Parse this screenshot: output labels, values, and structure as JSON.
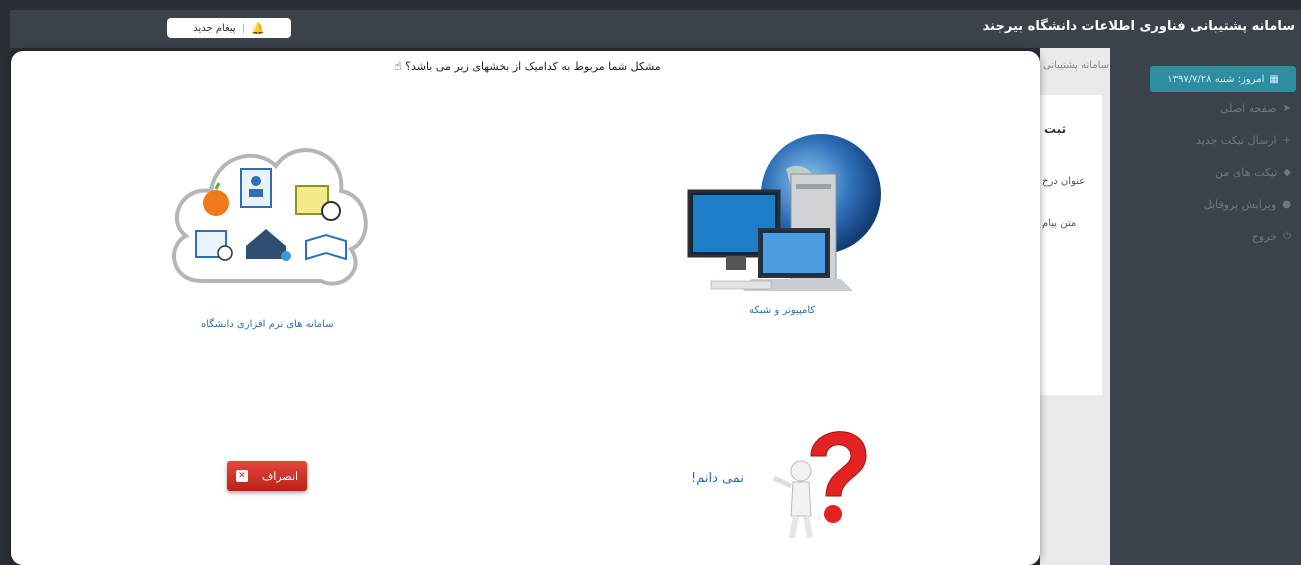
{
  "header": {
    "title": "سامانه پشتیبانی فناوری اطلاعات دانشگاه بیرجند",
    "new_message_label": "پیغام جدید",
    "bell_icon": "bell-icon",
    "separator": "|"
  },
  "sidebar": {
    "date_label": "امروز: شنبه ۱۳۹۷/۷/۲۸",
    "items": [
      {
        "label": "صفحه اصلی",
        "icon": "send-icon"
      },
      {
        "label": "ارسال تیکت جدید",
        "icon": "plus-icon"
      },
      {
        "label": "تیکت های من",
        "icon": "tag-icon"
      },
      {
        "label": "ویرایش پروفایل",
        "icon": "user-icon"
      },
      {
        "label": "خروج",
        "icon": "logout-icon"
      }
    ]
  },
  "background": {
    "breadcrumb": "سامانه پشتیبانی",
    "form_title": "ثبت",
    "subject_label": "عنوان درخ",
    "message_label": "متن پیام"
  },
  "modal": {
    "prompt": "مشکل شما مربوط به کدامیک از بخشهای زیر می باشد؟",
    "options": {
      "computer_network": "کامپیوتر و شبکه",
      "software_systems": "سامانه های نرم افزاری دانشگاه",
      "dont_know": "نمی دانم!"
    },
    "cancel_label": "انصراف"
  },
  "colors": {
    "header_bg": "#3b4249",
    "accent": "#2c8ea0",
    "link_blue": "#2e6fb6",
    "cancel_red": "#c0281d"
  }
}
